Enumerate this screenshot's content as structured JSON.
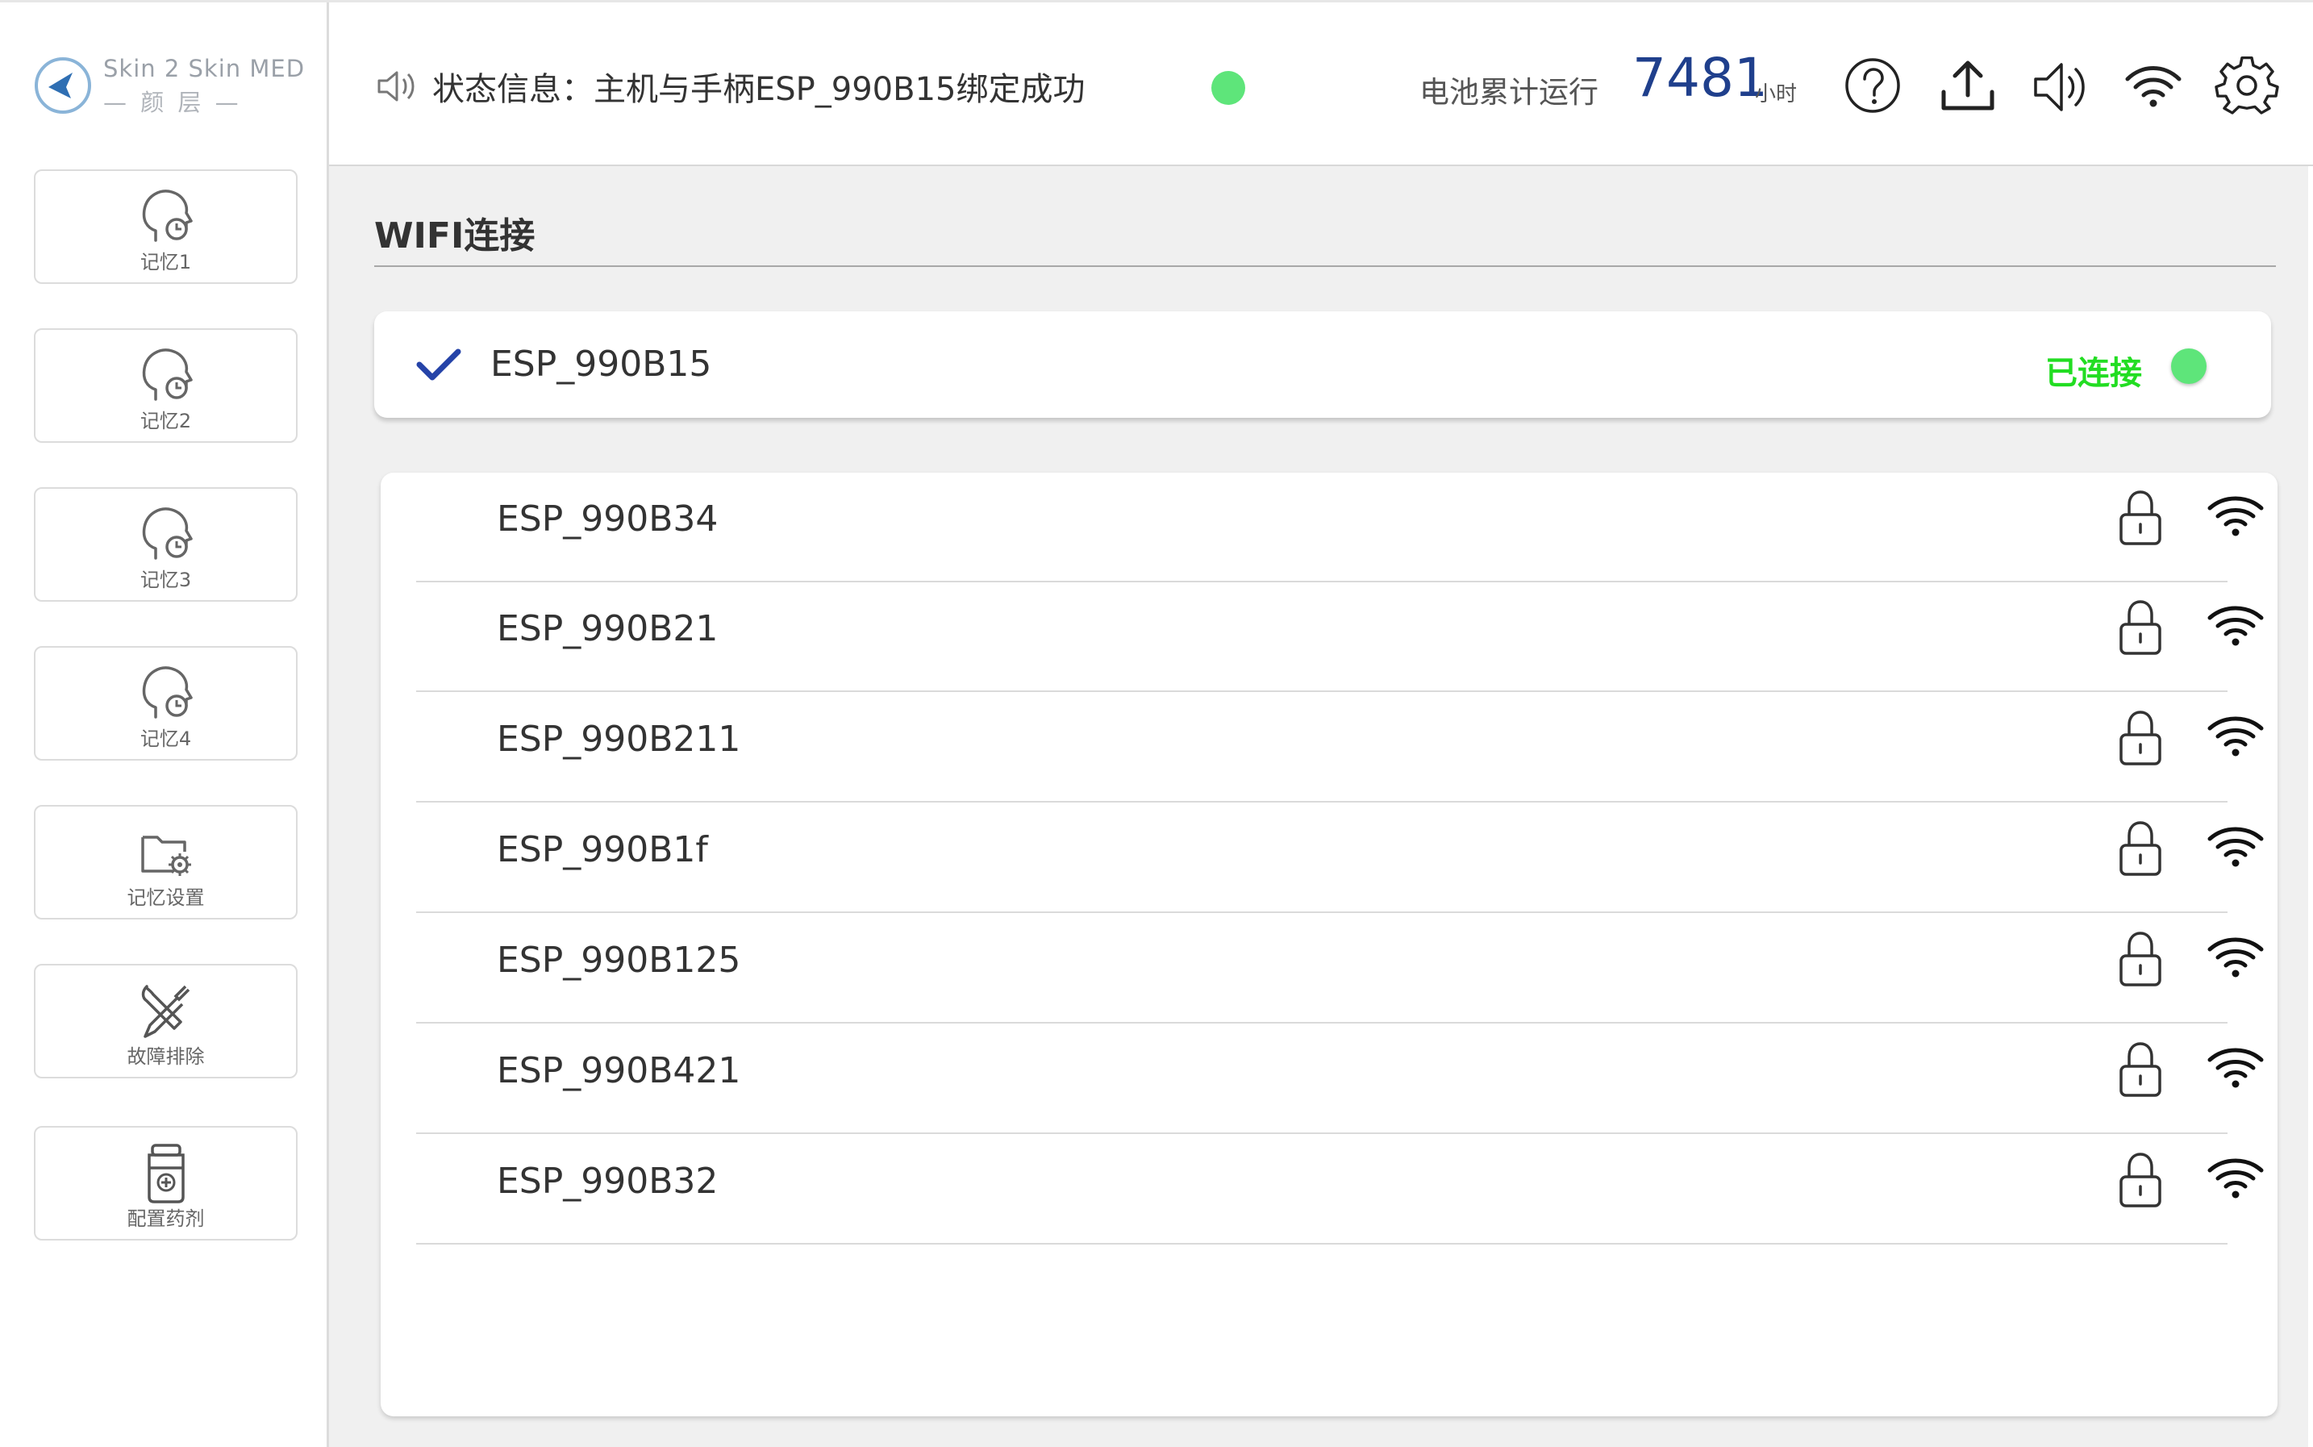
{
  "brand": {
    "logo_line1": "Skin 2 Skin MED",
    "logo_line2": "— 颜 层 —"
  },
  "sidebar": {
    "items": [
      {
        "label": "记忆1",
        "icon": "head-clock-icon"
      },
      {
        "label": "记忆2",
        "icon": "head-clock-icon"
      },
      {
        "label": "记忆3",
        "icon": "head-clock-icon"
      },
      {
        "label": "记忆4",
        "icon": "head-clock-icon"
      },
      {
        "label": "记忆设置",
        "icon": "folder-gear-icon"
      },
      {
        "label": "故障排除",
        "icon": "tools-icon"
      },
      {
        "label": "配置药剂",
        "icon": "medicine-jar-icon"
      }
    ]
  },
  "header": {
    "status_text": "状态信息：主机与手柄ESP_990B15绑定成功",
    "status_color": "#5ee57a",
    "battery_label": "电池累计运行",
    "battery_value": "7481",
    "battery_unit": "小时",
    "icons": [
      "help-icon",
      "upload-icon",
      "volume-icon",
      "wifi-icon",
      "settings-icon"
    ]
  },
  "wifi": {
    "title": "WIFI连接",
    "connected": {
      "ssid": "ESP_990B15",
      "status": "已连接",
      "status_color": "#22dd22"
    },
    "networks": [
      {
        "ssid": "ESP_990B34"
      },
      {
        "ssid": "ESP_990B21"
      },
      {
        "ssid": "ESP_990B211"
      },
      {
        "ssid": "ESP_990B1f"
      },
      {
        "ssid": "ESP_990B125"
      },
      {
        "ssid": "ESP_990B421"
      },
      {
        "ssid": "ESP_990B32"
      }
    ]
  }
}
